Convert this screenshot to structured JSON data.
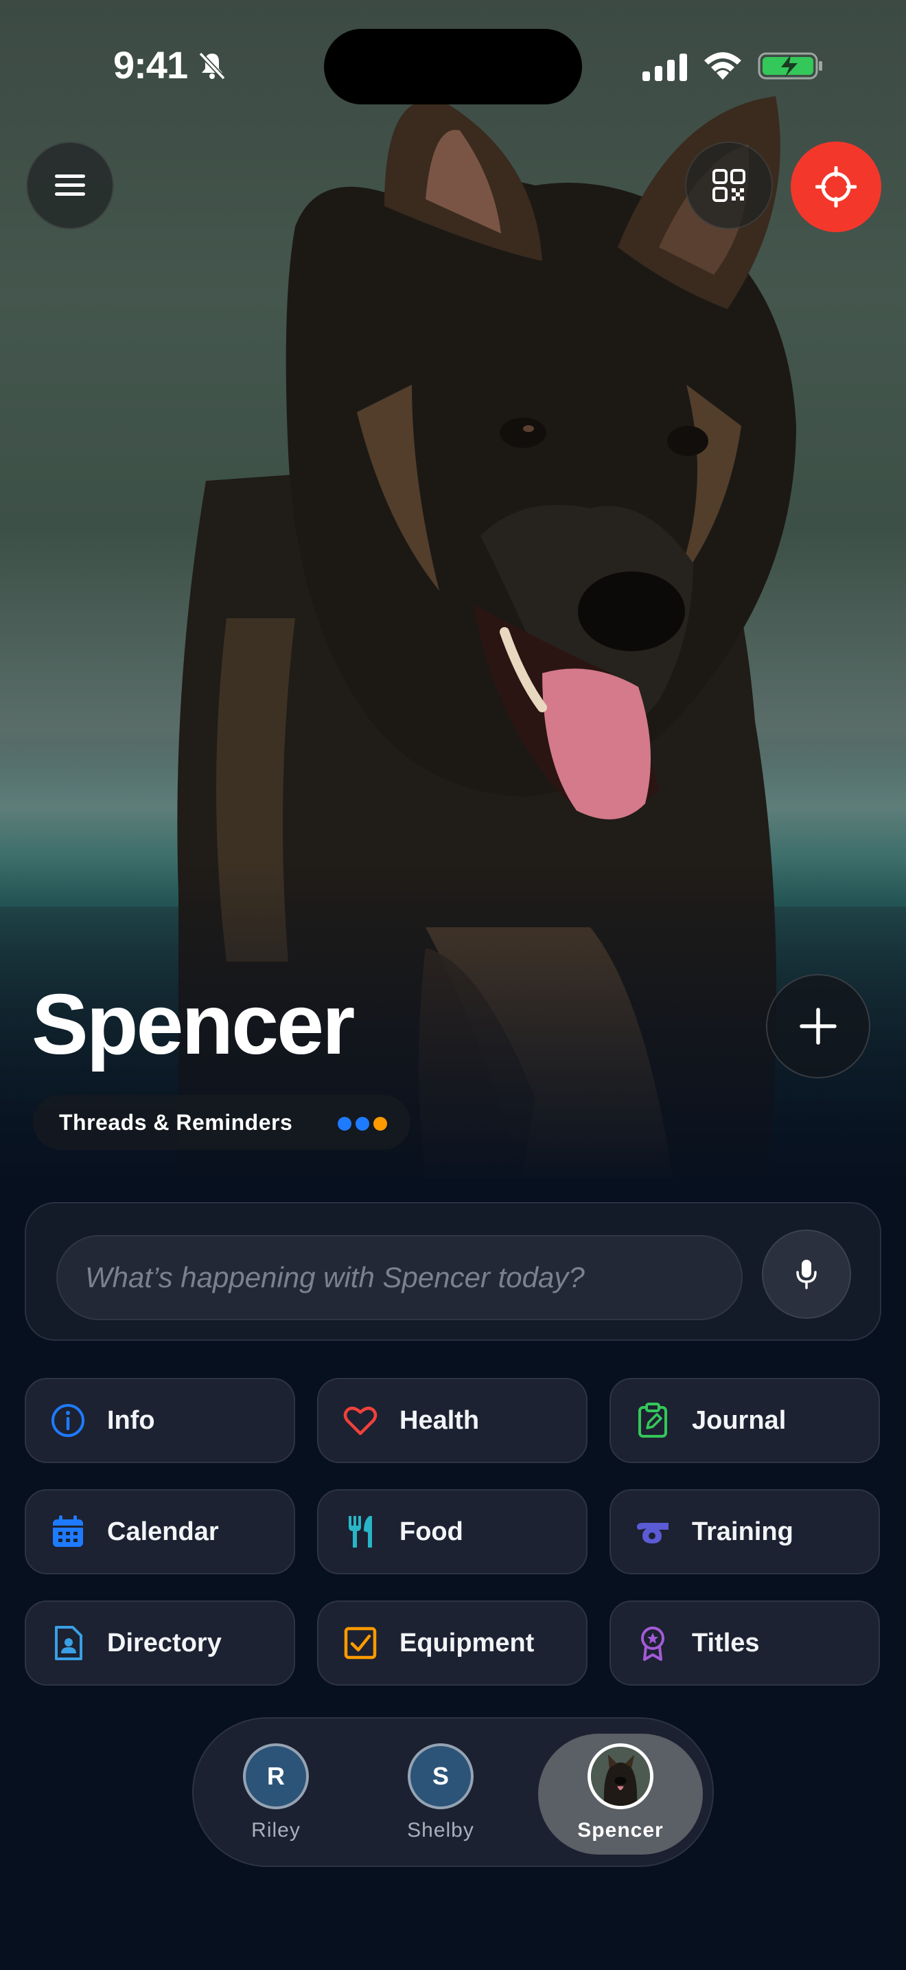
{
  "status_bar": {
    "time": "9:41"
  },
  "hero": {
    "pet_name": "Spencer",
    "threads_label": "Threads & Reminders",
    "thread_dot_colors": [
      "#1e7bff",
      "#1e7bff",
      "#ff9a00"
    ]
  },
  "composer": {
    "placeholder": "What’s happening with Spencer today?"
  },
  "categories": [
    {
      "label": "Info",
      "icon": "info-icon",
      "color": "#1e7bff"
    },
    {
      "label": "Health",
      "icon": "heart-icon",
      "color": "#f0413c"
    },
    {
      "label": "Journal",
      "icon": "clipboard-edit-icon",
      "color": "#34c759"
    },
    {
      "label": "Calendar",
      "icon": "calendar-icon",
      "color": "#1e7bff"
    },
    {
      "label": "Food",
      "icon": "fork-knife-icon",
      "color": "#28b6c8"
    },
    {
      "label": "Training",
      "icon": "whistle-icon",
      "color": "#5b5bd6"
    },
    {
      "label": "Directory",
      "icon": "contact-file-icon",
      "color": "#3aa0e6"
    },
    {
      "label": "Equipment",
      "icon": "checkbox-icon",
      "color": "#ff9a00"
    },
    {
      "label": "Titles",
      "icon": "award-ribbon-icon",
      "color": "#a35bd6"
    }
  ],
  "pets": [
    {
      "initial": "R",
      "name": "Riley",
      "active": false
    },
    {
      "initial": "S",
      "name": "Shelby",
      "active": false
    },
    {
      "initial": "",
      "name": "Spencer",
      "active": true
    }
  ],
  "colors": {
    "accent_red": "#f4372b",
    "background": "#07101f"
  }
}
